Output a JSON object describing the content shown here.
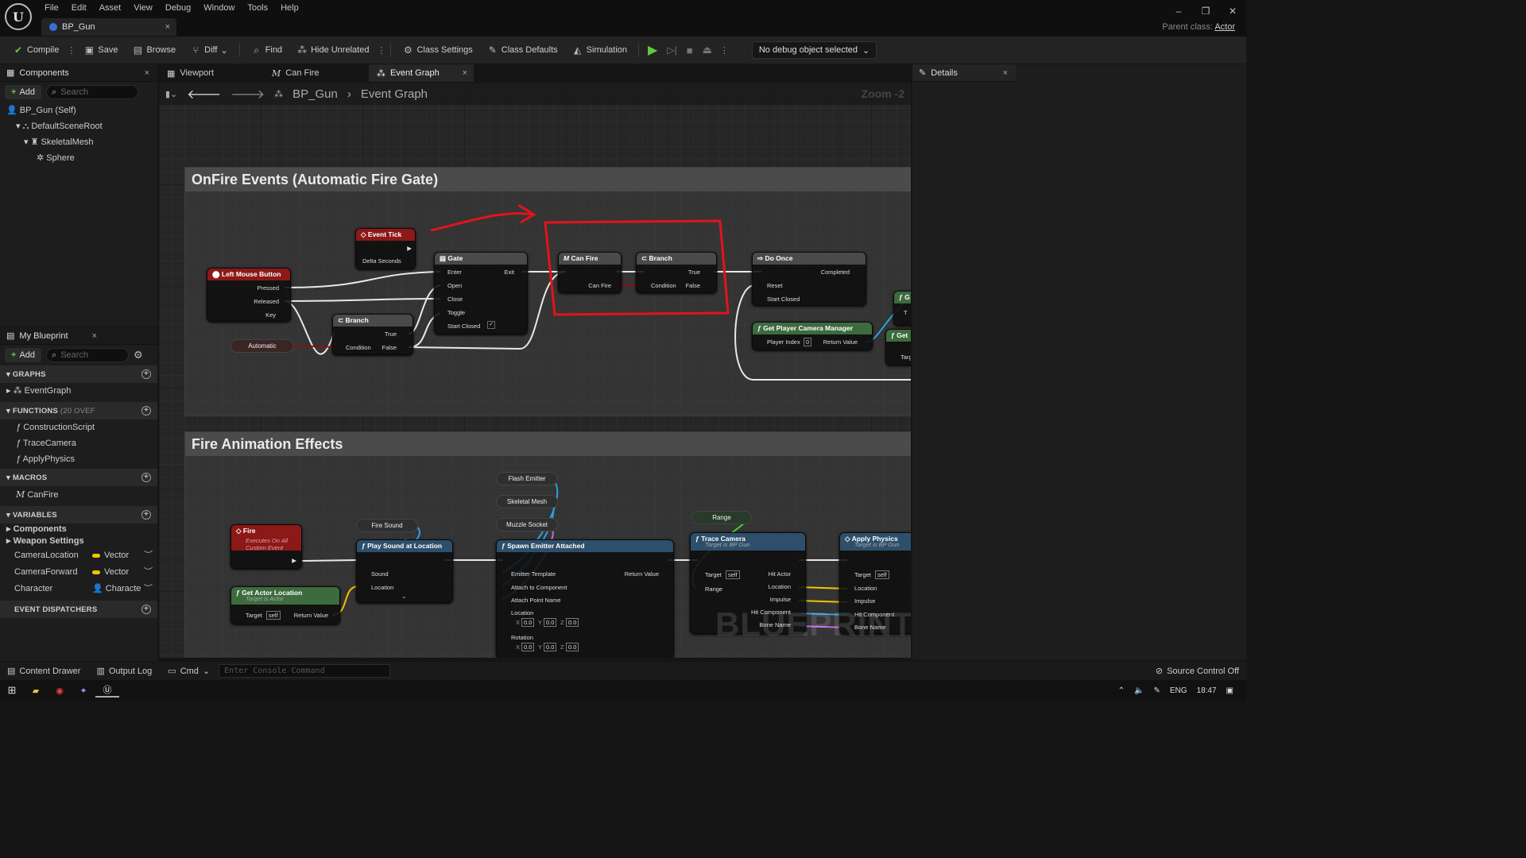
{
  "menu": [
    "File",
    "Edit",
    "Asset",
    "View",
    "Debug",
    "Window",
    "Tools",
    "Help"
  ],
  "tab": {
    "title": "BP_Gun",
    "close": "×"
  },
  "window": {
    "minimize": "–",
    "restore": "❐",
    "close": "✕",
    "parent_label": "Parent class:",
    "parent_value": "Actor"
  },
  "toolbar": {
    "compile": "Compile",
    "save": "Save",
    "browse": "Browse",
    "diff": "Diff",
    "find": "Find",
    "hide_unrelated": "Hide Unrelated",
    "class_settings": "Class Settings",
    "class_defaults": "Class Defaults",
    "simulation": "Simulation",
    "debug_object": "No debug object selected"
  },
  "components": {
    "tab": "Components",
    "add": "Add",
    "search_placeholder": "Search",
    "tree": [
      "BP_Gun (Self)",
      "DefaultSceneRoot",
      "SkeletalMesh",
      "Sphere"
    ]
  },
  "graph_tabs": [
    "Viewport",
    "Can Fire",
    "Event Graph"
  ],
  "breadcrumb": {
    "root": "BP_Gun",
    "sep": "›",
    "current": "Event Graph",
    "zoom": "Zoom -2"
  },
  "details": {
    "tab": "Details"
  },
  "my_blueprint": {
    "tab": "My Blueprint",
    "add": "Add",
    "search_placeholder": "Search",
    "graphs_label": "GRAPHS",
    "graphs": [
      "EventGraph"
    ],
    "functions_label": "FUNCTIONS",
    "functions_count": "(20 OVEF",
    "functions": [
      "ConstructionScript",
      "TraceCamera",
      "ApplyPhysics"
    ],
    "macros_label": "MACROS",
    "macros": [
      "CanFire"
    ],
    "variables_label": "VARIABLES",
    "var_groups": [
      "Components",
      "Weapon Settings"
    ],
    "variables": [
      {
        "name": "CameraLocation",
        "type": "Vector"
      },
      {
        "name": "CameraForward",
        "type": "Vector"
      },
      {
        "name": "Character",
        "type": "Characte"
      }
    ],
    "dispatchers_label": "EVENT DISPATCHERS"
  },
  "comments": {
    "onfire": "OnFire Events (Automatic Fire Gate)",
    "fireanim": "Fire Animation Effects"
  },
  "nodes": {
    "event_tick": {
      "title": "Event Tick",
      "pin": "Delta Seconds"
    },
    "lmb": {
      "title": "Left Mouse Button",
      "pins": [
        "Pressed",
        "Released",
        "Key"
      ]
    },
    "automatic": "Automatic",
    "branch1": {
      "title": "Branch",
      "pins": [
        "True",
        "Condition",
        "False"
      ]
    },
    "gate": {
      "title": "Gate",
      "pins": [
        "Enter",
        "Exit",
        "Open",
        "Close",
        "Toggle",
        "Start Closed"
      ]
    },
    "canfire": {
      "title": "Can Fire",
      "pin": "Can Fire"
    },
    "branch2": {
      "title": "Branch",
      "pins": [
        "True",
        "Condition",
        "False"
      ]
    },
    "doonce": {
      "title": "Do Once",
      "pins": [
        "Completed",
        "Reset",
        "Start Closed"
      ]
    },
    "gpcm": {
      "title": "Get Player Camera Manager",
      "pins": [
        "Player Index",
        "Return Value"
      ],
      "index": "0"
    },
    "partial": [
      "G",
      "T",
      "Get",
      "Targ"
    ],
    "fire": {
      "title": "Fire",
      "sub1": "Executes On All",
      "sub2": "Custom Event"
    },
    "fire_sound": "Fire Sound",
    "play_sound": {
      "title": "Play Sound at Location",
      "pins": [
        "Sound",
        "Location"
      ]
    },
    "get_actor_loc": {
      "title": "Get Actor Location",
      "sub": "Target is Actor",
      "pins": [
        "Target",
        "Return Value"
      ],
      "self": "self"
    },
    "flash": "Flash Emitter",
    "skel": "Skeletal Mesh",
    "muzzle": "Muzzle Socket",
    "spawn": {
      "title": "Spawn Emitter Attached",
      "pins": [
        "Emitter Template",
        "Return Value",
        "Attach to Component",
        "Attach Point Name",
        "Location",
        "Rotation"
      ],
      "zero": "0.0",
      "x": "X",
      "y": "Y",
      "z": "Z"
    },
    "range": "Range",
    "trace": {
      "title": "Trace Camera",
      "sub": "Target is BP Gun",
      "pins": [
        "Target",
        "Hit Actor",
        "Range",
        "Location",
        "Impulse",
        "Hit Component",
        "Bone Name"
      ],
      "self": "self"
    },
    "apply": {
      "title": "Apply Physics",
      "sub": "Target is BP Gun",
      "pins": [
        "Target",
        "Location",
        "Impulse",
        "Hit Component",
        "Bone Name"
      ],
      "self": "self"
    }
  },
  "watermark": "BLUEPRINT",
  "bottom": {
    "content_drawer": "Content Drawer",
    "output_log": "Output Log",
    "cmd": "Cmd",
    "console_placeholder": "Enter Console Command",
    "source_control": "Source Control Off"
  },
  "taskbar": {
    "lang": "ENG",
    "time": "18:47"
  }
}
